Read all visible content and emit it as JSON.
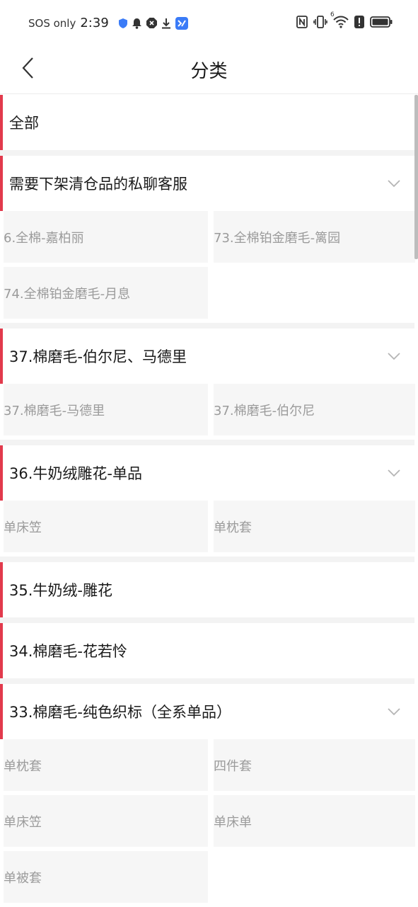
{
  "status_bar": {
    "carrier": "SOS only",
    "time": "2:39",
    "signal_label": "6"
  },
  "header": {
    "title": "分类"
  },
  "categories": [
    {
      "label": "全部",
      "expandable": false,
      "children": []
    },
    {
      "label": "需要下架清仓品的私聊客服",
      "expandable": true,
      "children": [
        "6.全棉-嘉柏丽",
        "73.全棉铂金磨毛-篱园",
        "74.全棉铂金磨毛-月息"
      ]
    },
    {
      "label": "37.棉磨毛-伯尔尼、马德里",
      "expandable": true,
      "children": [
        "37.棉磨毛-马德里",
        "37.棉磨毛-伯尔尼"
      ]
    },
    {
      "label": "36.牛奶绒雕花-单品",
      "expandable": true,
      "children": [
        "单床笠",
        "单枕套"
      ]
    },
    {
      "label": "35.牛奶绒-雕花",
      "expandable": false,
      "children": []
    },
    {
      "label": "34.棉磨毛-花若怜",
      "expandable": false,
      "children": []
    },
    {
      "label": "33.棉磨毛-纯色织标（全系单品）",
      "expandable": true,
      "children": [
        "单枕套",
        "四件套",
        "单床笠",
        "单床单",
        "单被套"
      ]
    }
  ],
  "colors": {
    "accent": "#e23a4c",
    "sub_item_bg": "#f6f6f6",
    "sub_item_text": "#9b9b9b"
  }
}
